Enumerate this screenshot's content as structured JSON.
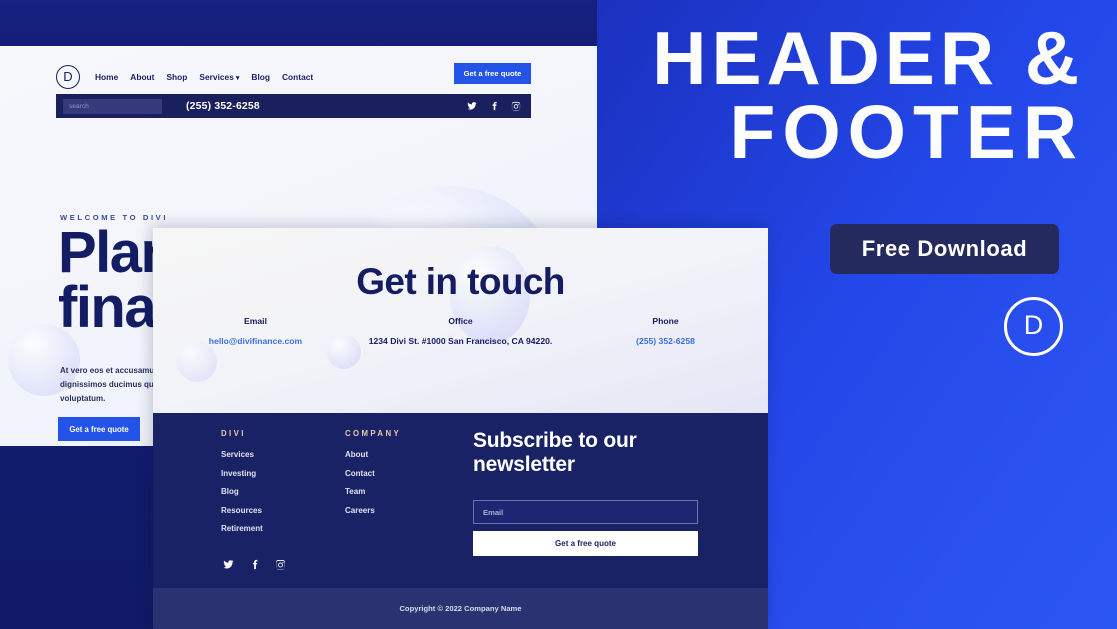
{
  "promo": {
    "title_line1": "HEADER &",
    "title_line2": "FOOTER",
    "badge_label": "Free Download",
    "logo_letter": "D"
  },
  "site": {
    "logo_letter": "D",
    "nav_items": [
      {
        "label": "Home"
      },
      {
        "label": "About"
      },
      {
        "label": "Shop"
      },
      {
        "label": "Services",
        "caret": "▾"
      },
      {
        "label": "Blog"
      },
      {
        "label": "Contact"
      }
    ],
    "nav_cta_label": "Get a free quote",
    "topbar": {
      "search_placeholder": "search",
      "phone": "(255) 352-6258",
      "social": [
        "twitter-icon",
        "facebook-icon",
        "instagram-icon"
      ]
    },
    "hero": {
      "eyebrow": "WELCOME TO DIVI",
      "title": "Plan your fina",
      "paragraph": "At vero eos et accusamus et iusto odio dignissimos ducimus qui blanditiis praesentium voluptatum.",
      "cta_label": "Get a free quote"
    }
  },
  "contact": {
    "title": "Get in touch",
    "columns": [
      {
        "heading": "Email",
        "value": "hello@divifinance.com",
        "is_link": true
      },
      {
        "heading": "Office",
        "value": "1234 Divi St. #1000 San Francisco, CA 94220.",
        "is_link": false
      },
      {
        "heading": "Phone",
        "value": "(255) 352-6258",
        "is_link": true
      }
    ]
  },
  "footer": {
    "columns": [
      {
        "heading": "DIVI",
        "links": [
          "Services",
          "Investing",
          "Blog",
          "Resources",
          "Retirement"
        ]
      },
      {
        "heading": "COMPANY",
        "links": [
          "About",
          "Contact",
          "Team",
          "Careers"
        ]
      }
    ],
    "social": [
      "twitter-icon",
      "facebook-icon",
      "instagram-icon"
    ],
    "subscribe": {
      "title": "Subscribe to our newsletter",
      "email_placeholder": "Email",
      "button_label": "Get a free quote"
    },
    "copyright": "Copyright © 2022 Company Name"
  },
  "colors": {
    "brand_blue": "#2453e8",
    "deep_navy": "#141c63",
    "footer_navy": "#1a2266",
    "copyright_navy": "#2b3272",
    "badge_navy": "#242a5e",
    "accent_tan": "#e8c9a8",
    "link_blue": "#3b6fe0"
  }
}
